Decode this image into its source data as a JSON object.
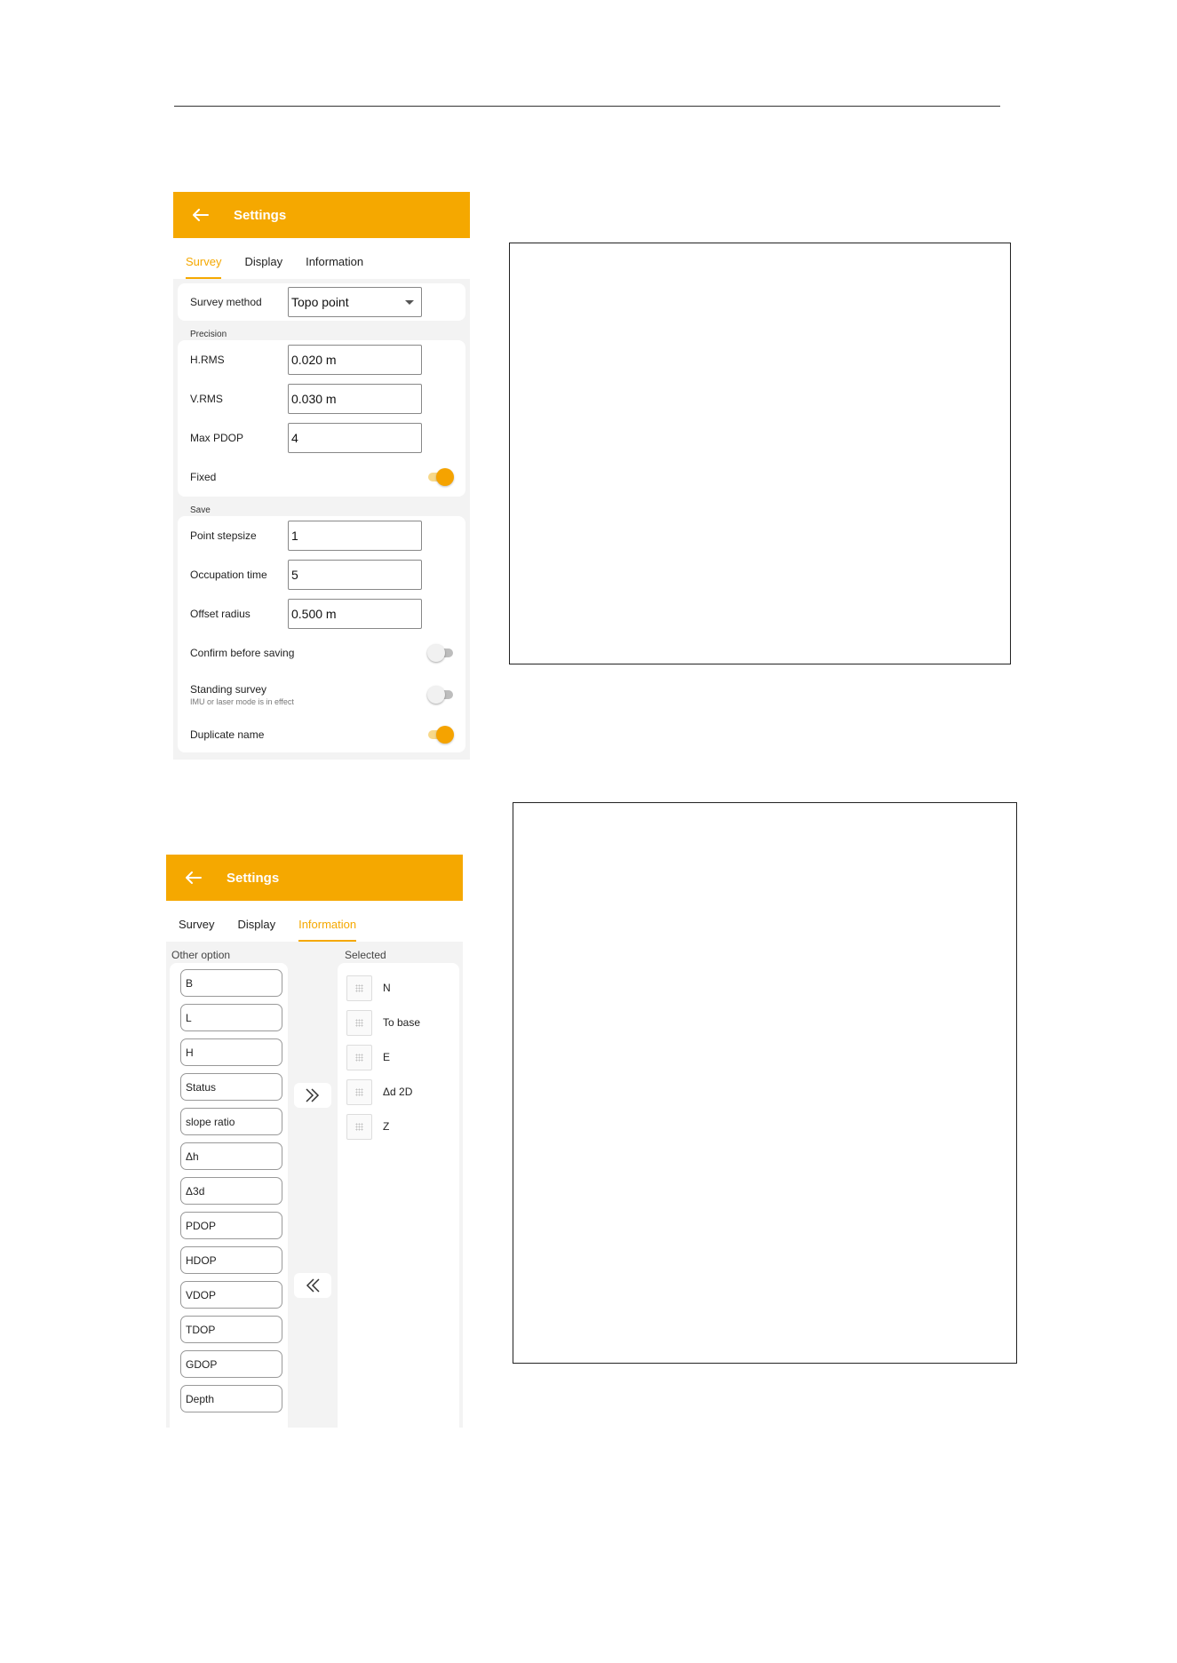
{
  "screen1": {
    "title": "Settings",
    "tabs": [
      "Survey",
      "Display",
      "Information"
    ],
    "survey_method": {
      "label": "Survey method",
      "value": "Topo point"
    },
    "precision_label": "Precision",
    "h_rms": {
      "label": "H.RMS",
      "value": "0.020 m"
    },
    "v_rms": {
      "label": "V.RMS",
      "value": "0.030 m"
    },
    "max_pdop": {
      "label": "Max PDOP",
      "value": "4"
    },
    "fixed": {
      "label": "Fixed",
      "on": true
    },
    "save_label": "Save",
    "point_stepsize": {
      "label": "Point stepsize",
      "value": "1"
    },
    "occupation_time": {
      "label": "Occupation time",
      "value": "5"
    },
    "offset_radius": {
      "label": "Offset radius",
      "value": "0.500 m"
    },
    "confirm_before_saving": {
      "label": "Confirm before saving",
      "on": false
    },
    "standing_survey": {
      "label": "Standing survey",
      "sub": "IMU or laser mode is in effect",
      "on": false
    },
    "duplicate_name": {
      "label": "Duplicate name",
      "on": true
    }
  },
  "screen2": {
    "title": "Settings",
    "tabs": [
      "Survey",
      "Display",
      "Information"
    ],
    "other_option_label": "Other option",
    "selected_label": "Selected",
    "other_options": [
      "B",
      "L",
      "H",
      "Status",
      "slope ratio",
      "Δh",
      "Δ3d",
      "PDOP",
      "HDOP",
      "VDOP",
      "TDOP",
      "GDOP",
      "Depth"
    ],
    "selected": [
      "N",
      "To base",
      "E",
      "Δd 2D",
      "Z"
    ]
  },
  "colors": {
    "accent": "#f5a800"
  },
  "icons": {
    "back": "arrow-left-icon",
    "add": "double-chevron-right-icon",
    "remove": "double-chevron-left-icon",
    "drag": "drag-handle-icon"
  }
}
